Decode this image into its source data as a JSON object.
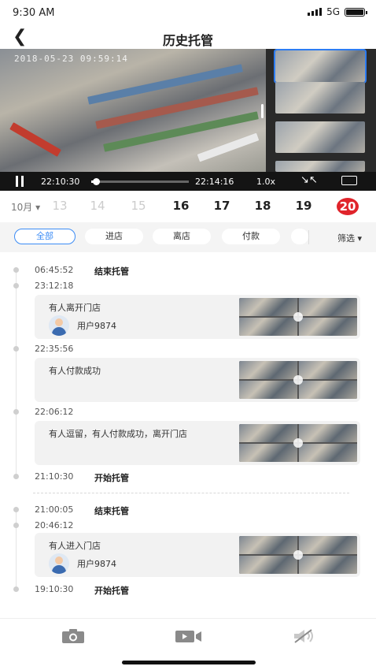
{
  "status_bar": {
    "time": "9:30 AM",
    "network": "5G"
  },
  "nav": {
    "title": "历史托管"
  },
  "video": {
    "timestamp_overlay": "2018-05-23 09:59:14",
    "current_time": "22:10:30",
    "end_time": "22:14:16",
    "speed": "1.0x",
    "progress": 0.05
  },
  "dates": {
    "month": "10月",
    "days": [
      "13",
      "14",
      "15",
      "16",
      "17",
      "18",
      "19",
      "20"
    ],
    "selected": "20"
  },
  "filters": {
    "chips": [
      "全部",
      "进店",
      "离店",
      "付款"
    ],
    "active": "全部",
    "filter_button": "筛选"
  },
  "timeline": {
    "group1": {
      "end": {
        "time": "06:45:52",
        "label": "结束托管"
      },
      "events": [
        {
          "time": "23:12:18",
          "message": "有人离开门店",
          "user": "用户9874"
        },
        {
          "time": "22:35:56",
          "message": "有人付款成功"
        },
        {
          "time": "22:06:12",
          "message": "有人逗留，有人付款成功，离开门店"
        }
      ],
      "start": {
        "time": "21:10:30",
        "label": "开始托管"
      }
    },
    "group2": {
      "end": {
        "time": "21:00:05",
        "label": "结束托管"
      },
      "events": [
        {
          "time": "20:46:12",
          "message": "有人进入门店",
          "user": "用户9874"
        }
      ],
      "start": {
        "time": "19:10:30",
        "label": "开始托管"
      }
    }
  },
  "bottom_tabs": [
    "camera-icon",
    "video-icon",
    "mute-icon"
  ]
}
